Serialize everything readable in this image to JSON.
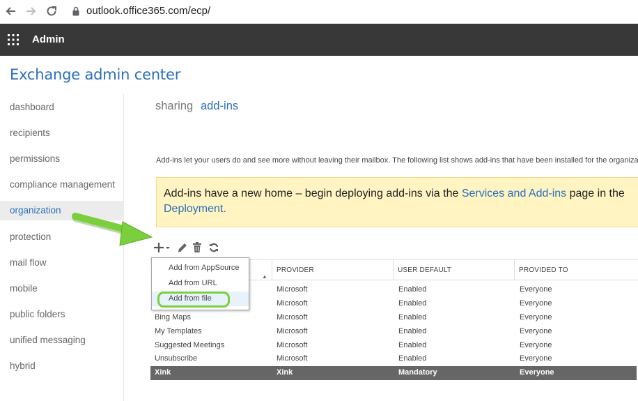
{
  "browser": {
    "url": "outlook.office365.com/ecp/",
    "icons": [
      "back-arrow-icon",
      "forward-arrow-icon",
      "reload-icon",
      "lock-icon"
    ]
  },
  "topbar": {
    "app_title": "Admin",
    "icon": "app-launcher-icon"
  },
  "page": {
    "title": "Exchange admin center"
  },
  "sidebar": {
    "items": [
      {
        "label": "dashboard",
        "active": false
      },
      {
        "label": "recipients",
        "active": false
      },
      {
        "label": "permissions",
        "active": false
      },
      {
        "label": "compliance management",
        "active": false
      },
      {
        "label": "organization",
        "active": true
      },
      {
        "label": "protection",
        "active": false
      },
      {
        "label": "mail flow",
        "active": false
      },
      {
        "label": "mobile",
        "active": false
      },
      {
        "label": "public folders",
        "active": false
      },
      {
        "label": "unified messaging",
        "active": false
      },
      {
        "label": "hybrid",
        "active": false
      }
    ]
  },
  "tabs": [
    {
      "label": "sharing",
      "active": false
    },
    {
      "label": "add-ins",
      "active": true
    }
  ],
  "description": "Add-ins let your users do and see more without leaving their mailbox. The following list shows add-ins that have been installed for the organiza",
  "banner": {
    "text_before": "Add-ins have a new home – begin deploying add-ins via the ",
    "link_text": "Services and Add-ins",
    "text_after": " page in the",
    "line2_link": "Deployment."
  },
  "toolbar": {
    "buttons": [
      "add-icon",
      "dropdown-caret-icon",
      "edit-icon",
      "delete-icon",
      "refresh-icon"
    ]
  },
  "add_menu": {
    "items": [
      {
        "label": "Add from AppSource"
      },
      {
        "label": "Add from URL"
      },
      {
        "label": "Add from file"
      }
    ]
  },
  "table": {
    "columns": [
      "",
      "PROVIDER",
      "USER DEFAULT",
      "PROVIDED TO"
    ],
    "rows": [
      {
        "name": "",
        "provider": "Microsoft",
        "user_default": "Enabled",
        "provided_to": "Everyone"
      },
      {
        "name": "",
        "provider": "Microsoft",
        "user_default": "Enabled",
        "provided_to": "Everyone"
      },
      {
        "name": "Bing Maps",
        "provider": "Microsoft",
        "user_default": "Enabled",
        "provided_to": "Everyone"
      },
      {
        "name": "My Templates",
        "provider": "Microsoft",
        "user_default": "Enabled",
        "provided_to": "Everyone"
      },
      {
        "name": "Suggested Meetings",
        "provider": "Microsoft",
        "user_default": "Enabled",
        "provided_to": "Everyone"
      },
      {
        "name": "Unsubscribe",
        "provider": "Microsoft",
        "user_default": "Enabled",
        "provided_to": "Everyone"
      },
      {
        "name": "Xink",
        "provider": "Xink",
        "user_default": "Mandatory",
        "provided_to": "Everyone"
      }
    ],
    "selected_row": 6
  },
  "colors": {
    "accent": "#2a6ebb",
    "topbar_bg": "#383838",
    "banner_bg": "#fff4c2",
    "selected_row_bg": "#666666",
    "annotation_green": "#7bcf3c"
  }
}
